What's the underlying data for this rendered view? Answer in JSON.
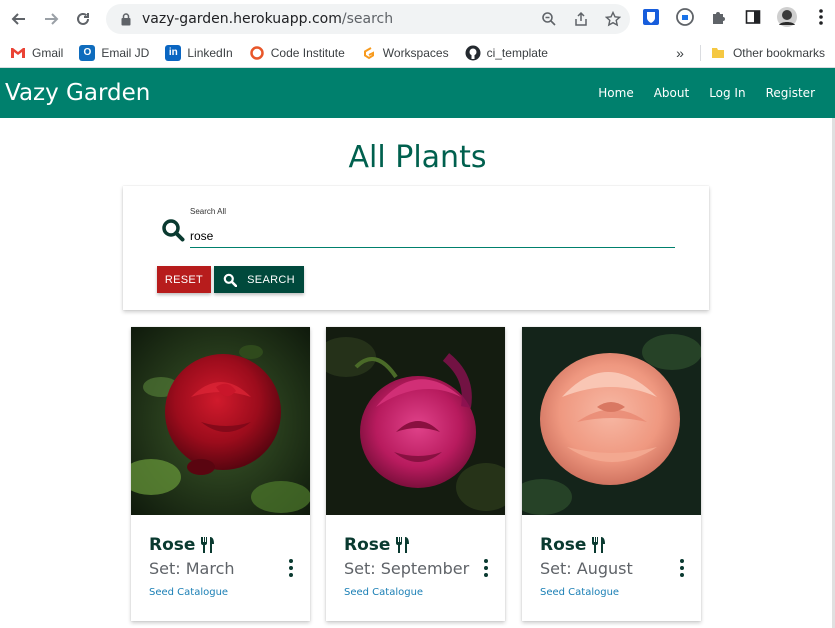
{
  "browser": {
    "url_host": "vazy-garden.herokuapp.com",
    "url_path": "/search",
    "bookmarks": [
      {
        "label": "Gmail",
        "icon": "gmail-icon",
        "color": "#ea4335"
      },
      {
        "label": "Email JD",
        "icon": "outlook-icon",
        "color": "#0f6cbd"
      },
      {
        "label": "LinkedIn",
        "icon": "linkedin-icon",
        "color": "#0a66c2"
      },
      {
        "label": "Code Institute",
        "icon": "code-institute-icon",
        "color": "#e8572a"
      },
      {
        "label": "Workspaces",
        "icon": "gitpod-icon",
        "color": "#f79a1e"
      },
      {
        "label": "ci_template",
        "icon": "github-icon",
        "color": "#24292f"
      }
    ],
    "more_bookmarks": "»",
    "other_bookmarks": "Other bookmarks"
  },
  "navbar": {
    "brand": "Vazy Garden",
    "links": [
      "Home",
      "About",
      "Log In",
      "Register"
    ],
    "color": "#00806d"
  },
  "main": {
    "title": "All Plants",
    "search": {
      "label": "Search All",
      "value": "rose",
      "reset_label": "RESET",
      "search_label": "SEARCH"
    },
    "cards": [
      {
        "title": "Rose",
        "set": "Set: March",
        "link": "Seed Catalogue",
        "image": "red rose"
      },
      {
        "title": "Rose",
        "set": "Set: September",
        "link": "Seed Catalogue",
        "image": "magenta rose"
      },
      {
        "title": "Rose",
        "set": "Set: August",
        "link": "Seed Catalogue",
        "image": "peach rose"
      }
    ]
  }
}
